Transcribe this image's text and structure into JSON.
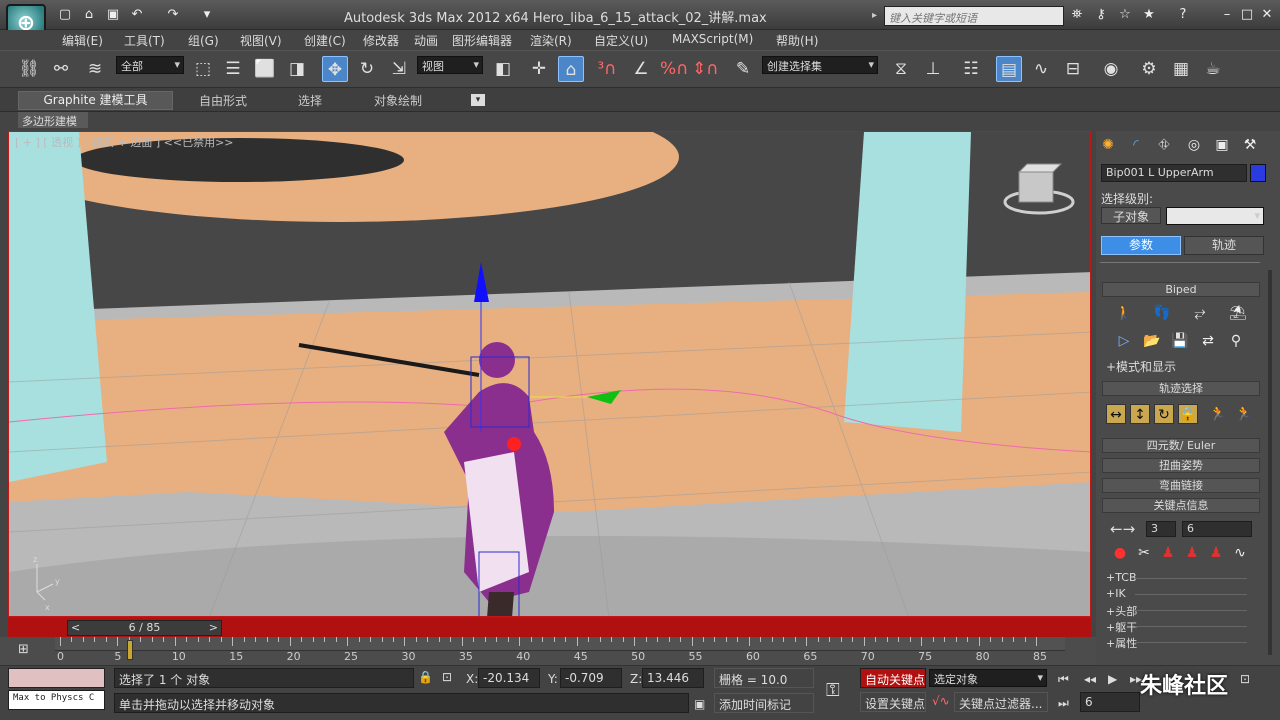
{
  "app": {
    "title": "Autodesk 3ds Max  2012 x64",
    "file": "Hero_liba_6_15_attack_02_讲解.max",
    "search_placeholder": "键入关键字或短语",
    "logo": "⊕"
  },
  "menu": [
    "编辑(E)",
    "工具(T)",
    "组(G)",
    "视图(V)",
    "创建(C)",
    "修改器",
    "动画",
    "图形编辑器",
    "渲染(R)",
    "自定义(U)",
    "MAXScript(M)",
    "帮助(H)"
  ],
  "toolbar": {
    "filter": "全部",
    "ref_coord": "视图",
    "selset": "创建选择集"
  },
  "ribbon": {
    "tabs": [
      "Graphite 建模工具",
      "自由形式",
      "选择",
      "对象绘制"
    ],
    "sub": "多边形建模"
  },
  "viewport": {
    "label": "[ + ] [ 透视 ] [ 真实 + 边面 ] <<已禁用>>"
  },
  "timeline": {
    "frame": "6 / 85",
    "ticks": [
      "0",
      "5",
      "10",
      "15",
      "20",
      "25",
      "30",
      "35",
      "40",
      "45",
      "50",
      "55",
      "60",
      "65",
      "70",
      "75",
      "80",
      "85"
    ]
  },
  "status": {
    "maxscript": "Max to Physcs C",
    "selected": "选择了 1 个 对象",
    "prompt": "单击并拖动以选择并移动对象",
    "x": "-20.134",
    "y": "-0.709",
    "z": "13.446",
    "grid": "栅格 = 10.0",
    "add_tag": "添加时间标记",
    "autokey": "自动关键点",
    "setkey": "设置关键点",
    "selected_obj": "选定对象",
    "key_filters": "关键点过滤器...",
    "frame_field": "6"
  },
  "cmd": {
    "object_name": "Bip001 L UpperArm",
    "sel_level": "选择级别:",
    "subobj": "子对象",
    "params": "参数",
    "track": "轨迹",
    "rollouts": {
      "biped": "Biped",
      "mode": "+模式和显示",
      "track_sel": "轨迹选择",
      "quat": "四元数/ Euler",
      "twist": "扭曲姿势",
      "bend": "弯曲链接",
      "keyinfo": "关键点信息"
    },
    "keynum": "3",
    "keyval": "6",
    "sub": [
      "+TCB",
      "+IK",
      "+头部",
      "+躯干",
      "+属性"
    ]
  },
  "watermark": "朱峰社区",
  "colors": {
    "accent": "#4a86c8",
    "timebar": "#b01010",
    "autokey": "#b01010",
    "ground": "#e8b080",
    "pillar": "#a8e0e0"
  }
}
